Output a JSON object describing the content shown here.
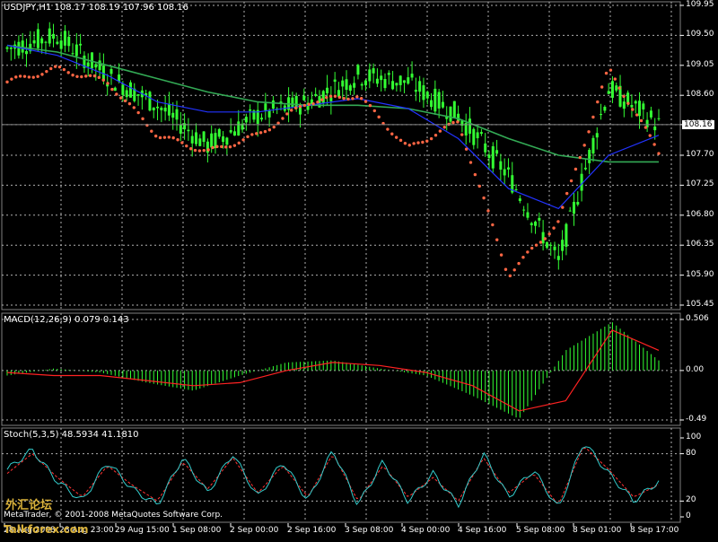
{
  "main_panel": {
    "symbol_label": "USDJPY,H1",
    "ohlc_label": "108.17 108.19 107.96 108.16",
    "current_price_label": "108.16",
    "price_ticks": [
      "109.95",
      "109.50",
      "109.05",
      "108.60",
      "108.16",
      "107.70",
      "107.25",
      "106.80",
      "106.35",
      "105.90",
      "105.45"
    ]
  },
  "macd_panel": {
    "label": "MACD(12,26,9) 0.079 0.143",
    "ticks": [
      "0.506",
      "0.00",
      "-0.49"
    ]
  },
  "stoch_panel": {
    "label": "Stoch(5,3,5) 48.5934 41.1810",
    "ticks": [
      "100",
      "80",
      "20",
      "0"
    ]
  },
  "time_axis": {
    "labels": [
      "28 Aug 2008",
      "28 Aug 23:00",
      "29 Aug 15:00",
      "1 Sep 08:00",
      "2 Sep 00:00",
      "2 Sep 16:00",
      "3 Sep 08:00",
      "4 Sep 00:00",
      "4 Sep 16:00",
      "5 Sep 08:00",
      "8 Sep 01:00",
      "8 Sep 17:00"
    ]
  },
  "footer": {
    "copyright": "MetaTrader, © 2001-2008 MetaQuotes Software Corp.",
    "watermark_cn": "外汇论坛",
    "watermark_en": "Talkforex.com"
  },
  "colors": {
    "background": "#000000",
    "grid": "#b0b0b0",
    "bull_candle": "#33ff33",
    "sar_dots": "#ff6644",
    "ma_fast": "#ff3333",
    "ma_mid": "#2233ff",
    "ma_slow": "#33aa55",
    "macd_hist": "#33ff33",
    "macd_signal": "#ff2222",
    "stoch_main": "#33cccc",
    "stoch_signal": "#ff3333",
    "text": "#ffffff"
  },
  "chart_data": {
    "type": "line",
    "title": "USDJPY,H1",
    "x": [
      "28 Aug 2008",
      "28 Aug 23:00",
      "29 Aug 15:00",
      "1 Sep 08:00",
      "2 Sep 00:00",
      "2 Sep 16:00",
      "3 Sep 08:00",
      "4 Sep 00:00",
      "4 Sep 16:00",
      "5 Sep 08:00",
      "8 Sep 01:00",
      "8 Sep 17:00"
    ],
    "ylim": [
      105.45,
      109.95
    ],
    "series": [
      {
        "name": "close",
        "values": [
          109.3,
          109.5,
          108.9,
          108.45,
          107.85,
          108.3,
          108.5,
          108.9,
          108.8,
          108.3,
          107.4,
          106.1,
          108.7,
          108.16
        ]
      },
      {
        "name": "sar",
        "values": [
          108.8,
          109.0,
          108.8,
          108.0,
          107.75,
          108.0,
          108.5,
          108.6,
          107.8,
          108.2,
          105.9,
          106.7,
          109.0,
          107.75
        ]
      },
      {
        "name": "ma_slow",
        "values": [
          109.35,
          109.25,
          109.05,
          108.85,
          108.65,
          108.5,
          108.45,
          108.45,
          108.4,
          108.25,
          107.95,
          107.7,
          107.6,
          107.6
        ]
      },
      {
        "name": "ma_mid",
        "values": [
          109.35,
          109.2,
          108.9,
          108.5,
          108.35,
          108.35,
          108.45,
          108.55,
          108.4,
          107.95,
          107.2,
          106.9,
          107.7,
          108.0
        ]
      }
    ],
    "macd": {
      "ylim": [
        -0.49,
        0.506
      ],
      "histogram": [
        -0.05,
        0.02,
        -0.02,
        -0.12,
        -0.2,
        -0.05,
        0.08,
        0.1,
        0.02,
        -0.05,
        -0.25,
        -0.48,
        0.2,
        0.48,
        0.1
      ],
      "signal": [
        -0.02,
        -0.05,
        -0.05,
        -0.1,
        -0.15,
        -0.12,
        0.0,
        0.08,
        0.05,
        -0.02,
        -0.15,
        -0.4,
        -0.3,
        0.4,
        0.2
      ]
    },
    "stochastic": {
      "ylim": [
        0,
        100
      ],
      "levels": [
        20,
        80
      ],
      "main": [
        60,
        85,
        45,
        20,
        70,
        35,
        15,
        75,
        30,
        80,
        25,
        70,
        20,
        85,
        15,
        70,
        20,
        55,
        15,
        80,
        25,
        60,
        10,
        95,
        55,
        20,
        45
      ],
      "signal": [
        55,
        80,
        50,
        25,
        65,
        40,
        20,
        70,
        35,
        75,
        30,
        65,
        25,
        80,
        20,
        65,
        25,
        50,
        20,
        75,
        30,
        55,
        15,
        90,
        60,
        25,
        41
      ]
    }
  }
}
